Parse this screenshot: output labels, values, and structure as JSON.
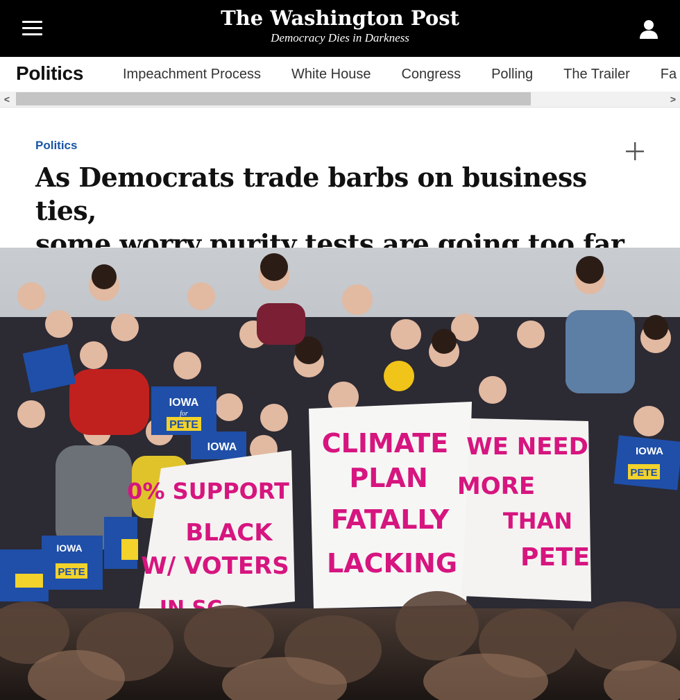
{
  "masthead": {
    "brand_name": "The Washington Post",
    "tagline": "Democracy Dies in Darkness",
    "menu_icon": "hamburger-menu-icon",
    "account_icon": "user-account-icon"
  },
  "section_nav": {
    "section_title": "Politics",
    "items": [
      {
        "label": "Impeachment Process"
      },
      {
        "label": "White House"
      },
      {
        "label": "Congress"
      },
      {
        "label": "Polling"
      },
      {
        "label": "The Trailer"
      },
      {
        "label": "Fa"
      }
    ]
  },
  "scrollbar": {
    "left_arrow": "<",
    "right_arrow": ">"
  },
  "article": {
    "kicker": "Politics",
    "headline_line1": "As Democrats trade barbs on business ties,",
    "headline_line2": "some worry purity tests are going too far",
    "add_icon": "plus-icon"
  },
  "photo": {
    "signs": {
      "sign1_line1": "0% SUPPORT",
      "sign1_line2": "BLACK",
      "sign1_line3": "W/ VOTERS",
      "sign1_line4": "IN SC",
      "sign2_line1": "CLIMATE",
      "sign2_line2": "PLAN",
      "sign2_line3": "FATALLY",
      "sign2_line4": "LACKING",
      "sign3_line1": "WE NEED",
      "sign3_line2": "MORE",
      "sign3_line3": "THAN",
      "sign3_line4": "PETE",
      "placard_top": "IOWA",
      "placard_mid": "for",
      "placard_bottom": "PETE"
    }
  },
  "colors": {
    "masthead_bg": "#000000",
    "kicker_blue": "#1955a5",
    "sign_magenta": "#d6157f",
    "placard_blue": "#1f4fa8",
    "placard_yellow": "#f2d22b"
  }
}
